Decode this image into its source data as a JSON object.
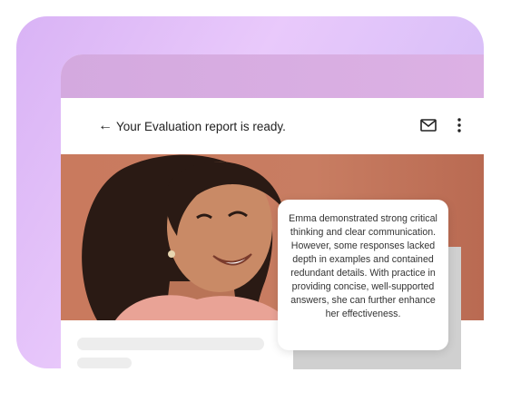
{
  "header": {
    "back_arrow": "←",
    "title": "Your Evaluation report is ready."
  },
  "icons": {
    "mail": "mail-icon",
    "more": "more-vertical-icon"
  },
  "summary": {
    "text": "Emma demonstrated strong critical thinking and clear communication. However, some responses lacked depth in examples and contained redundant details. With practice in providing concise, well-supported answers, she can further enhance her effectiveness."
  },
  "colors": {
    "background_gradient_start": "#d9b3f5",
    "background_gradient_end": "#cdb8f6",
    "photo_backdrop": "#c97a5e"
  }
}
